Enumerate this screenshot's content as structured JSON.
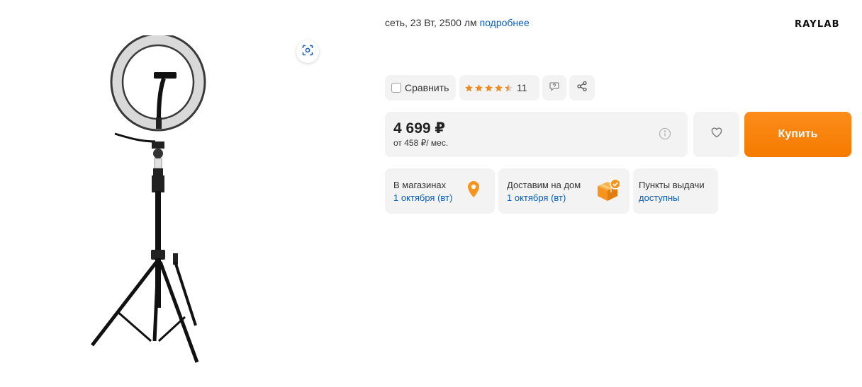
{
  "spec": {
    "text": "сеть, 23 Вт, 2500 лм",
    "more_link": "подробнее"
  },
  "brand": {
    "logo_text": "RAYLAB"
  },
  "actions": {
    "compare_label": "Сравнить",
    "rating_stars": 4.5,
    "rating_count": "11",
    "reviews_icon": "reviews-icon",
    "share_icon": "share-icon"
  },
  "price": {
    "amount": "4 699 ₽",
    "installment": "от 458 ₽/ мес."
  },
  "buy": {
    "label": "Купить"
  },
  "availability": {
    "stores": {
      "title": "В магазинах",
      "date": "1 октября (вт)"
    },
    "delivery": {
      "title": "Доставим на дом",
      "date": "1 октября (вт)"
    },
    "pickup": {
      "title": "Пункты выдачи",
      "status": "доступны"
    }
  },
  "colors": {
    "accent_orange": "#f57b00",
    "star_orange": "#f08a1c",
    "link_blue": "#0d5fb5",
    "chip_bg": "#f3f3f3"
  }
}
